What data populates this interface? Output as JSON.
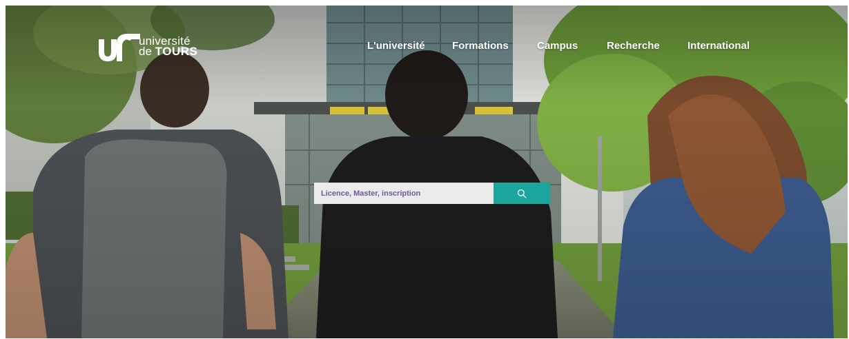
{
  "brand": {
    "logo_line1": "université",
    "logo_line2_prefix": "de ",
    "logo_line2_bold": "TOURS"
  },
  "nav": {
    "items": [
      "L'université",
      "Formations",
      "Campus",
      "Recherche",
      "International"
    ]
  },
  "search": {
    "placeholder": "Licence, Master, inscription",
    "icon": "search-icon"
  },
  "colors": {
    "search_button": "#1aa69c",
    "search_field": "#ebebeb",
    "placeholder_text": "#6d5a9a",
    "nav_text": "#ffffff"
  }
}
